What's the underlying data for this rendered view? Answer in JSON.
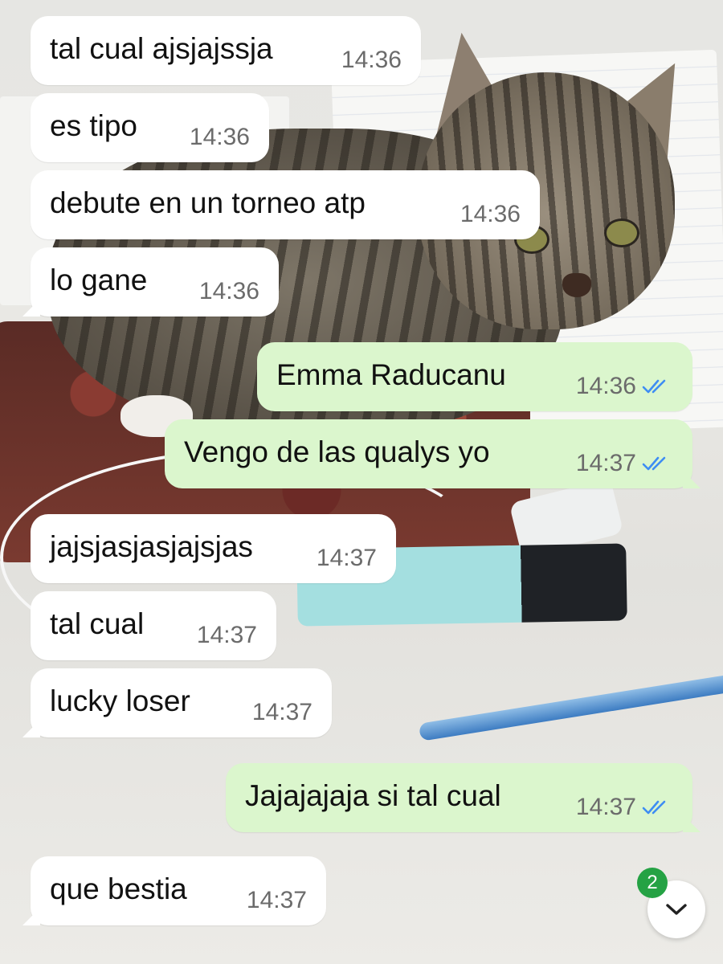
{
  "messages": [
    {
      "direction": "in",
      "text": "tal cual ajsjajssja",
      "time": "14:36",
      "tail": false
    },
    {
      "direction": "in",
      "text": "es tipo",
      "time": "14:36",
      "tail": false
    },
    {
      "direction": "in",
      "text": "debute en un torneo atp",
      "time": "14:36",
      "tail": false
    },
    {
      "direction": "in",
      "text": "lo gane",
      "time": "14:36",
      "tail": true
    },
    {
      "direction": "out",
      "text": "Emma Raducanu",
      "time": "14:36",
      "tail": false,
      "status": "read"
    },
    {
      "direction": "out",
      "text": "Vengo de las qualys yo",
      "time": "14:37",
      "tail": true,
      "status": "read"
    },
    {
      "direction": "in",
      "text": "jajsjasjasjajsjas",
      "time": "14:37",
      "tail": false
    },
    {
      "direction": "in",
      "text": "tal cual",
      "time": "14:37",
      "tail": false
    },
    {
      "direction": "in",
      "text": "lucky loser",
      "time": "14:37",
      "tail": true
    },
    {
      "direction": "out",
      "text": "Jajajajaja si tal cual",
      "time": "14:37",
      "tail": true,
      "status": "read"
    },
    {
      "direction": "in",
      "text": "que bestia",
      "time": "14:37",
      "tail": true
    }
  ],
  "scroll_button": {
    "icon": "chevron-down-icon",
    "unread_count": "2"
  },
  "colors": {
    "incoming_bubble": "#ffffff",
    "outgoing_bubble": "#dbf6cd",
    "read_ticks": "#3e8df3",
    "unread_badge": "#25a244"
  }
}
